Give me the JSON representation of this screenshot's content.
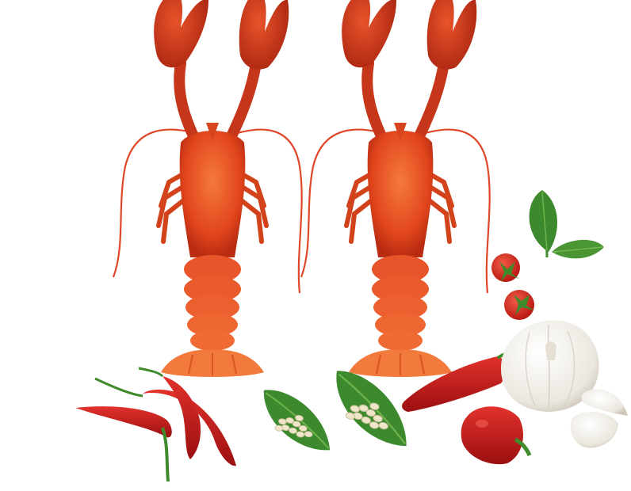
{
  "scene": {
    "background": "#ffffff",
    "items": [
      {
        "name": "lobster",
        "count": 2
      },
      {
        "name": "red-chili-pepper",
        "count": 3
      },
      {
        "name": "basil-leaf-with-peppercorns",
        "count": 2
      },
      {
        "name": "basil-sprig",
        "count": 1
      },
      {
        "name": "cherry-tomato",
        "count": 2
      },
      {
        "name": "red-pepper-halves",
        "count": 2
      },
      {
        "name": "garlic-bulb",
        "count": 1
      },
      {
        "name": "garlic-clove",
        "count": 2
      }
    ]
  },
  "colors": {
    "lobster_main": "#e2461c",
    "lobster_dark": "#b92c12",
    "lobster_light": "#f27a3d",
    "lobster_tail": "#f06a2c",
    "chili": "#c8161a",
    "chili_dark": "#8f0d0f",
    "stem": "#3f8a2a",
    "leaf": "#3d8a2e",
    "leaf_light": "#6fb24b",
    "peppercorn": "#efe6c9",
    "tomato": "#d8211b",
    "garlic": "#f1efea",
    "garlic_shadow": "#d8d2c6"
  }
}
